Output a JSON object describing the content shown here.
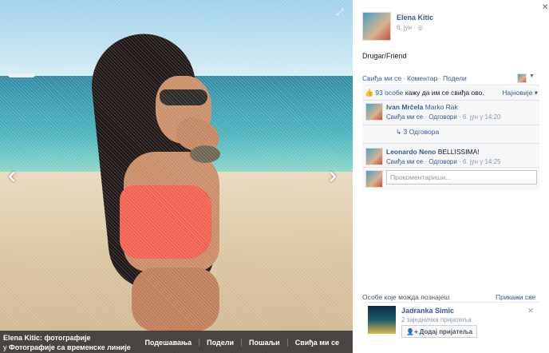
{
  "photo": {
    "caption_owner": "Elena Kitic: фотографије",
    "caption_sub_prefix": "у ",
    "caption_sub_album": "Фотографије са временске линије",
    "actions": [
      "Подешавања",
      "Подели",
      "Пошаљи",
      "Свиђа ми се"
    ]
  },
  "panel": {
    "owner_name": "Elena Kitic",
    "post_date": "6. јун",
    "audience_icon": "globe-icon",
    "caption_text": "Drugar/Friend",
    "actions": {
      "like": "Свиђа ми се",
      "comment": "Коментар",
      "share": "Подели",
      "separator": "·"
    },
    "likes_count_text": "93 особе",
    "likes_suffix": " кажу да им се свиђа ово.",
    "sort_label": "Најновије",
    "comments": [
      {
        "author": "Ivan Mrčela",
        "text": "Marko Rak",
        "like": "Свиђа ми се",
        "reply": "Одговори",
        "time": "6. јун у 14:20"
      },
      {
        "author": "Leonardo Neno",
        "text": "BELLISSIMA!",
        "like": "Свиђа ми се",
        "reply": "Одговори",
        "time": "6. јун у 14:25"
      }
    ],
    "replies_label": "3 Одговора",
    "comment_placeholder": "Прокоментариши..."
  },
  "pymk": {
    "title": "Особе које можда познајеш",
    "see_all": "Прикажи све",
    "name": "Jadranka Simic",
    "mutual": "2 заједничка пријатеља",
    "add_button": "Додај пријатеља"
  },
  "colors": {
    "link": "#3b5998",
    "grey_text": "#9197a3",
    "feedback_bg": "#f6f7f9"
  }
}
